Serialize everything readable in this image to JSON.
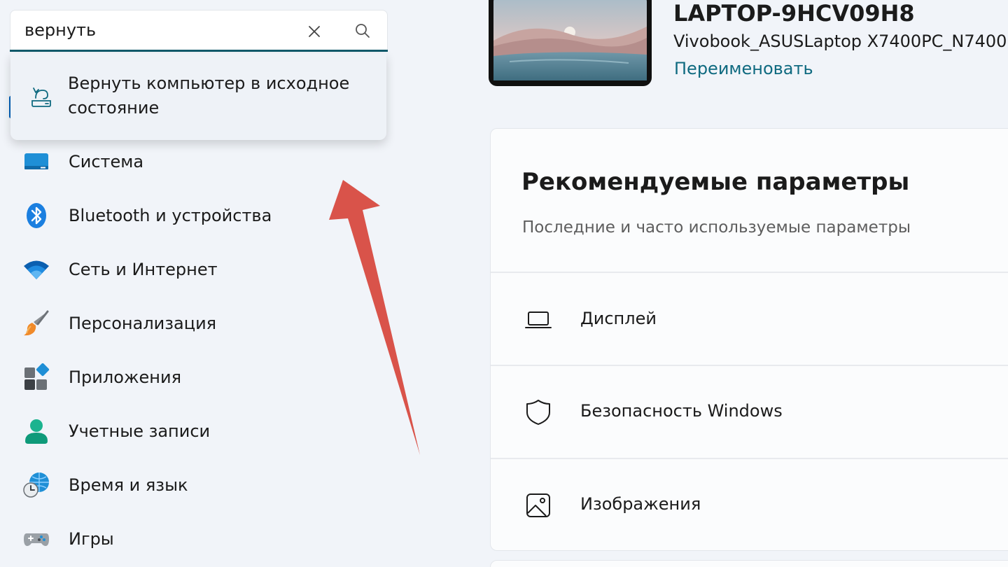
{
  "search": {
    "value": "вернуть",
    "clear_icon": "close-icon",
    "search_icon": "search-icon",
    "suggestion": {
      "icon": "reset-pc-icon",
      "label": "Вернуть компьютер в исходное состояние"
    }
  },
  "sidebar": {
    "items": [
      {
        "label": "Система",
        "icon": "system-display-icon"
      },
      {
        "label": "Bluetooth и устройства",
        "icon": "bluetooth-icon"
      },
      {
        "label": "Сеть и Интернет",
        "icon": "wifi-icon"
      },
      {
        "label": "Персонализация",
        "icon": "brush-icon"
      },
      {
        "label": "Приложения",
        "icon": "apps-icon"
      },
      {
        "label": "Учетные записи",
        "icon": "account-icon"
      },
      {
        "label": "Время и язык",
        "icon": "time-language-icon"
      },
      {
        "label": "Игры",
        "icon": "gamepad-icon"
      }
    ]
  },
  "device": {
    "name": "LAPTOP-9HCV09H8",
    "model": "Vivobook_ASUSLaptop X7400PC_N7400P",
    "rename_label": "Переименовать"
  },
  "recommended": {
    "title": "Рекомендуемые параметры",
    "subtitle": "Последние и часто используемые параметры",
    "rows": [
      {
        "label": "Дисплей",
        "icon": "laptop-icon"
      },
      {
        "label": "Безопасность Windows",
        "icon": "shield-icon"
      },
      {
        "label": "Изображения",
        "icon": "image-icon"
      }
    ]
  },
  "colors": {
    "accent": "#005fb8",
    "link": "#0f6a80",
    "arrow": "#d9534a"
  }
}
